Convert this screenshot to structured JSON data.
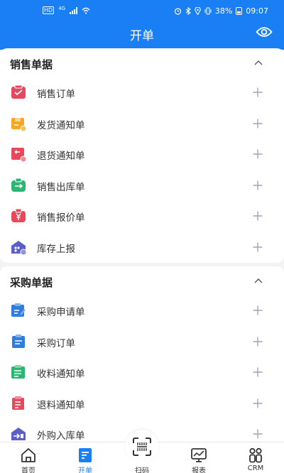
{
  "status_bar": {
    "network": "HD",
    "signal_badge": "4G",
    "battery": "38%",
    "time": "09:07"
  },
  "header": {
    "title": "开单"
  },
  "sections": [
    {
      "title": "销售单据",
      "items": [
        {
          "label": "销售订单",
          "icon": "sales-order-icon",
          "color": "#e8485c"
        },
        {
          "label": "发货通知单",
          "icon": "delivery-notice-icon",
          "color": "#f5a623"
        },
        {
          "label": "退货通知单",
          "icon": "return-notice-icon",
          "color": "#e8485c"
        },
        {
          "label": "销售出库单",
          "icon": "sales-outbound-icon",
          "color": "#2bb673"
        },
        {
          "label": "销售报价单",
          "icon": "sales-quote-icon",
          "color": "#e8485c"
        },
        {
          "label": "库存上报",
          "icon": "inventory-report-icon",
          "color": "#5b5fc7"
        }
      ]
    },
    {
      "title": "采购单据",
      "items": [
        {
          "label": "采购申请单",
          "icon": "purchase-request-icon",
          "color": "#2f7de1"
        },
        {
          "label": "采购订单",
          "icon": "purchase-order-icon",
          "color": "#2f7de1"
        },
        {
          "label": "收料通知单",
          "icon": "receiving-notice-icon",
          "color": "#2bb673"
        },
        {
          "label": "退料通知单",
          "icon": "material-return-icon",
          "color": "#e8485c"
        },
        {
          "label": "外购入库单",
          "icon": "purchase-inbound-icon",
          "color": "#5b5fc7"
        }
      ]
    }
  ],
  "tabs": [
    {
      "label": "首页",
      "icon": "home-icon"
    },
    {
      "label": "开单",
      "icon": "document-edit-icon",
      "active": true
    },
    {
      "label": "扫码",
      "icon": "scan-icon"
    },
    {
      "label": "报表",
      "icon": "report-chart-icon"
    },
    {
      "label": "CRM",
      "icon": "crm-icon"
    }
  ],
  "colors": {
    "primary": "#1a7ff5",
    "background": "#f2f3f5",
    "plus": "#9aa6b4"
  }
}
